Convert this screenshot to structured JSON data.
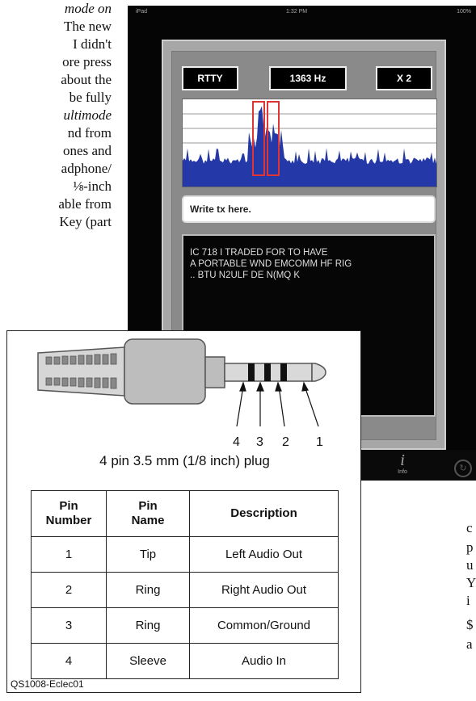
{
  "article": {
    "left_column": [
      "mode on",
      "The new",
      "I didn't",
      "ore press",
      "about the",
      "be fully",
      "",
      "ultimode",
      "nd from",
      "ones and",
      "adphone/",
      "⅛-inch",
      "able from",
      "Key (part"
    ],
    "right_column": [
      "c",
      "p",
      "u",
      "Y",
      "i",
      "",
      "$",
      "a"
    ]
  },
  "ipad": {
    "status_left": "iPad",
    "status_time": "1:32 PM",
    "status_right": "100%",
    "mode": "RTTY",
    "frequency": "1363 Hz",
    "zoom": "X 2",
    "tx_placeholder": "Write tx here.",
    "rx_lines": [
      "IC 718 I TRADED FOR TO HAVE",
      "A PORTABLE WND EMCOMM HF RIG",
      ".. BTU N2ULF DE N(MQ K"
    ],
    "info_tab_label": "Info",
    "info_icon": "info-icon",
    "colors": {
      "waterfall": "#2438a8",
      "marker": "#e03333"
    }
  },
  "figure": {
    "pin_callouts": [
      "4",
      "3",
      "2",
      "1"
    ],
    "caption": "4 pin 3.5 mm (1/8 inch) plug",
    "table": {
      "headers": [
        "Pin\nNumber",
        "Pin\nName",
        "Description"
      ],
      "rows": [
        [
          "1",
          "Tip",
          "Left Audio Out"
        ],
        [
          "2",
          "Ring",
          "Right Audio Out"
        ],
        [
          "3",
          "Ring",
          "Common/Ground"
        ],
        [
          "4",
          "Sleeve",
          "Audio In"
        ]
      ]
    },
    "figure_id": "QS1008-Eclec01"
  }
}
